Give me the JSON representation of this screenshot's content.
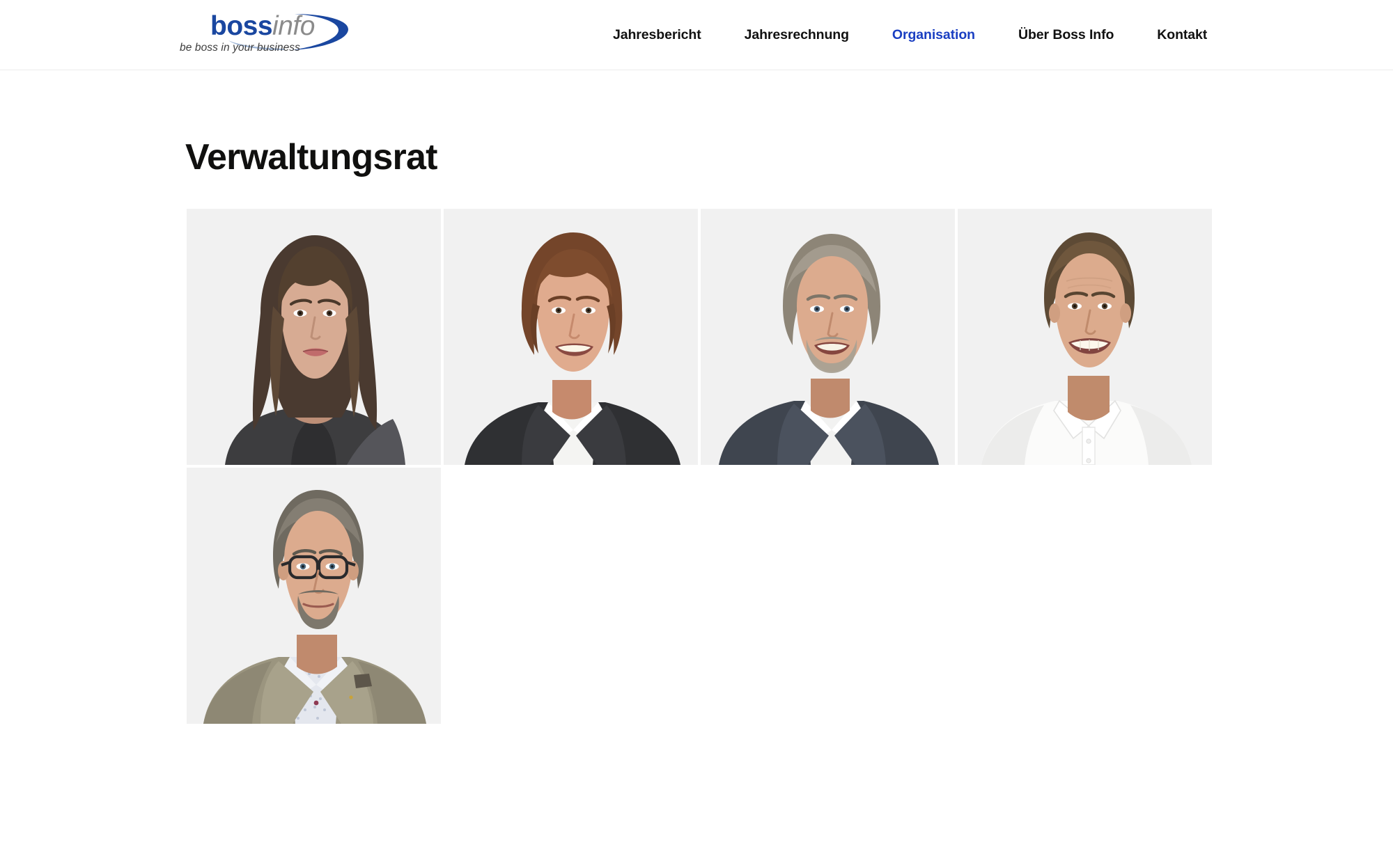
{
  "header": {
    "brand": {
      "name": "boss info",
      "word_primary": "boss",
      "word_secondary": "info",
      "tagline": "be boss in your business",
      "primary_color": "#1a47a0",
      "secondary_color": "#8b8b8b"
    },
    "nav": {
      "active_color": "#1a3fc2",
      "items": [
        {
          "label": "Jahresbericht",
          "active": false
        },
        {
          "label": "Jahresrechnung",
          "active": false
        },
        {
          "label": "Organisation",
          "active": true
        },
        {
          "label": "Über Boss Info",
          "active": false
        },
        {
          "label": "Kontakt",
          "active": false
        }
      ]
    }
  },
  "main": {
    "title": "Verwaltungsrat",
    "grid": {
      "background_color": "#f1f1f1",
      "columns": 4,
      "portraits": [
        {
          "name": "portrait-1",
          "description": "Frau mit langen dunkelbraunen Haaren, dunkle Jacke",
          "hair": "#4a3a30",
          "hair_light": "#6b5446",
          "skin": "#d7ab93",
          "skin_shadow": "#bd8f77",
          "clothing": "#3d3d3f",
          "clothing_light": "#58585b",
          "shirt": "#2e2e30"
        },
        {
          "name": "portrait-2",
          "description": "Mann mit rotbraunen welligen Haaren, dunkler Anzug, weisses Hemd",
          "hair": "#74452a",
          "hair_light": "#95603d",
          "skin": "#e0ab8e",
          "skin_shadow": "#c68a6d",
          "clothing": "#2f3033",
          "clothing_light": "#45474b",
          "shirt": "#f4f4f2"
        },
        {
          "name": "portrait-3",
          "description": "Mann mit grauen Haaren und Bart, graublauer Anzug, weisses Hemd",
          "hair": "#8d8577",
          "hair_light": "#aaa294",
          "skin": "#dcab8e",
          "skin_shadow": "#c08a6d",
          "clothing": "#3f454f",
          "clothing_light": "#565d69",
          "shirt": "#f2f2f1"
        },
        {
          "name": "portrait-4",
          "description": "Mann mit kurzen braunen Haaren, weisses Polohemd",
          "hair": "#5d4a35",
          "hair_light": "#7b6549",
          "skin": "#dcab8d",
          "skin_shadow": "#c08b6c",
          "clothing": "#fbfbfa",
          "clothing_light": "#ececeb",
          "shirt": "#ffffff"
        },
        {
          "name": "portrait-5",
          "description": "Mann mit Brille, graumeliertes Haar, Ziegenbart, beiger Tweed-Sakko",
          "hair": "#6f6a60",
          "hair_light": "#918b80",
          "skin": "#dcab8e",
          "skin_shadow": "#c08a6d",
          "clothing": "#9b957f",
          "clothing_light": "#b2ac96",
          "shirt": "#e4e7ee",
          "glasses": "#2a2a2c"
        }
      ]
    }
  }
}
